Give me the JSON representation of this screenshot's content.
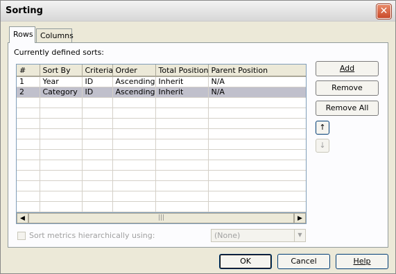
{
  "window": {
    "title": "Sorting",
    "close_symbol": "✕"
  },
  "tabs": [
    {
      "label": "Rows"
    },
    {
      "label": "Columns"
    }
  ],
  "section_label": "Currently defined sorts:",
  "grid": {
    "columns": [
      "#",
      "Sort By",
      "Criteria",
      "Order",
      "Total Position",
      "Parent Position"
    ],
    "rows": [
      {
        "num": "1",
        "sort_by": "Year",
        "criteria": "ID",
        "order": "Ascending",
        "total_position": "Inherit",
        "parent_position": "N/A"
      },
      {
        "num": "2",
        "sort_by": "Category",
        "criteria": "ID",
        "order": "Ascending",
        "total_position": "Inherit",
        "parent_position": "N/A"
      }
    ]
  },
  "side_buttons": {
    "add": "Add",
    "remove": "Remove",
    "remove_all": "Remove All",
    "move_up": "↑",
    "move_down": "↓"
  },
  "options": {
    "hierarchical_checkbox_label": "Sort metrics hierarchically using:",
    "hierarchical_checked": false,
    "hierarchy_select_value": "(None)"
  },
  "footer": {
    "ok": "OK",
    "cancel": "Cancel",
    "help": "Help"
  },
  "colors": {
    "selected_row": "#c0c0cc",
    "window_bg": "#ece9d8",
    "close_button": "#c9492a"
  },
  "scrollbar": {
    "left_arrow": "◀",
    "right_arrow": "▶",
    "grip": "|||"
  },
  "select_arrow": "▼"
}
